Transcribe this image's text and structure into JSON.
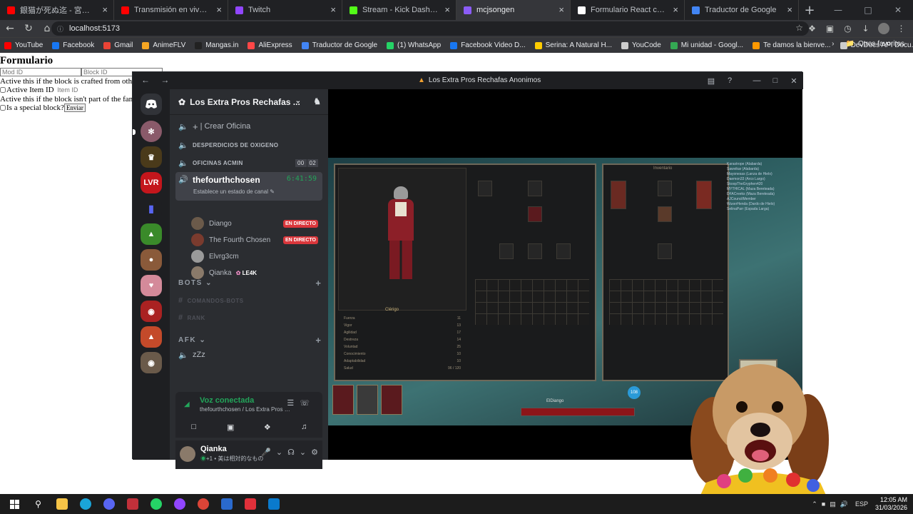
{
  "browser": {
    "tabs": [
      {
        "label": "銀猫が死ぬ迄 - 宮下遊 × ツミキ（Of",
        "color": "#ff0000",
        "active": false
      },
      {
        "label": "Transmisión en vivo - YouTube Stu",
        "color": "#ff0000",
        "active": false
      },
      {
        "label": "Twitch",
        "color": "#9146ff",
        "active": false
      },
      {
        "label": "Stream - Kick Dashboard",
        "color": "#53fc18",
        "active": false
      },
      {
        "label": "mcjsongen",
        "color": "#8b5cf6",
        "active": true
      },
      {
        "label": "Formulario React con checkboxes",
        "color": "#ffffff",
        "active": false
      },
      {
        "label": "Traductor de Google",
        "color": "#4285f4",
        "active": false
      }
    ],
    "url": "localhost:5173",
    "bookmarks": [
      {
        "label": "YouTube",
        "color": "#ff0000"
      },
      {
        "label": "Facebook",
        "color": "#1877f2"
      },
      {
        "label": "Gmail",
        "color": "#ea4335"
      },
      {
        "label": "AnimeFLV",
        "color": "#f5a623"
      },
      {
        "label": "Mangas.in",
        "color": "#222222"
      },
      {
        "label": "AliExpress",
        "color": "#ff4747"
      },
      {
        "label": "Traductor de Google",
        "color": "#4285f4"
      },
      {
        "label": "(1) WhatsApp",
        "color": "#25d366"
      },
      {
        "label": "Facebook Video D...",
        "color": "#1877f2"
      },
      {
        "label": "Serina: A Natural H...",
        "color": "#ffcc00"
      },
      {
        "label": "YouCode",
        "color": "#cccccc"
      },
      {
        "label": "Mi unidad - Googl...",
        "color": "#34a853"
      },
      {
        "label": "Te damos la bienve...",
        "color": "#ff9900"
      },
      {
        "label": "DevDocs API Docu...",
        "color": "#cccccc"
      }
    ],
    "other_bookmarks": "Otros favoritos"
  },
  "form": {
    "title": "Formulario",
    "mod_id_placeholder": "Mod ID",
    "block_id_placeholder": "Block ID",
    "line1": "Active this if the block is crafted from other",
    "active_item_label": "Active Item ID",
    "item_id_placeholder": "Item ID",
    "line2": "Active this if the block isn't part of the fami",
    "special_label": "Is a special block?",
    "submit_label": "Enviar"
  },
  "discord": {
    "window_title": "Los Extra Pros Rechafas Anonimos",
    "guild_name": "Los Extra Pros Rechafas ...",
    "channels": {
      "crear_oficina": "| Crear Oficina",
      "desperdicios": "DESPERDICIOS DE OXIGENO",
      "oficinas": "OFICINAS ACMIN",
      "oficinas_count_a": "00",
      "oficinas_count_b": "02",
      "active_channel": "thefourthchosen",
      "active_timer": "6:41:59",
      "active_status": "Establece un estado de canal"
    },
    "voice_users": [
      {
        "name": "Diango",
        "live": "EN DIRECTO",
        "color": "#6b5a4a"
      },
      {
        "name": "The Fourth Chosen",
        "live": "EN DIRECTO",
        "color": "#7a3b2e"
      },
      {
        "name": "Elvrg3cm",
        "live": "",
        "color": "#9a9a9a"
      },
      {
        "name": "Qianka",
        "live": "",
        "color": "#8a7a6a"
      }
    ],
    "qianka_tag": "LE4K",
    "categories": {
      "bots": "BOTS",
      "comandos_bots": "COMANDOS-BOTS",
      "rank": "RANK",
      "afk": "AFK",
      "afk_channel": "zZz"
    },
    "voice_connected": {
      "status": "Voz conectada",
      "location": "thefourthchosen / Los Extra Pros Recha..."
    },
    "user_panel": {
      "name": "Qianka",
      "status_prefix": "+1 • ",
      "status": "美は相対的なもの"
    },
    "server_badge": "LVR"
  },
  "game": {
    "panel_left_title": "Clérigo",
    "panel_right_title": "Inventario",
    "hud_name": "ElDiango",
    "stats": [
      "Fuerza",
      "Vigor",
      "Agilidad",
      "Destreza",
      "Voluntad",
      "Conocimiento",
      "Adaptabilidad",
      "Salud"
    ],
    "stat_values": [
      "11",
      "13",
      "17",
      "14",
      "25",
      "10",
      "10",
      "96 / 120"
    ],
    "feed": [
      "Karastrope (Alabarda)",
      "Sawvikar (Alabarda)",
      "Mayonesas (Lanza de Hielo)",
      "Daemon33 (Arco Largo)",
      "SkoopTheGryphen420",
      "MYTHICAL (Maza Bereteada)",
      "DFACreeks (Maza Bereteada)",
      "AJCouncilMember",
      "WuxerHenda (Dardo de Hielo)",
      "SelinaParr (Espada Larga)"
    ],
    "level_badge": "108"
  },
  "taskbar": {
    "lang": "ESP",
    "time": "12:05 AM",
    "date": "31/03/2026"
  }
}
